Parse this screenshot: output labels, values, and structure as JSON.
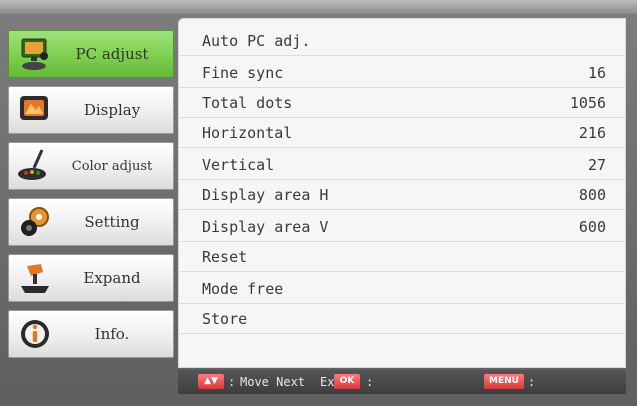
{
  "sidebar": {
    "items": [
      {
        "label": "PC adjust",
        "icon": "monitor-person-icon",
        "active": true
      },
      {
        "label": "Display",
        "icon": "display-icon",
        "active": false
      },
      {
        "label": "Color adjust",
        "icon": "brush-icon",
        "active": false
      },
      {
        "label": "Setting",
        "icon": "gears-icon",
        "active": false
      },
      {
        "label": "Expand",
        "icon": "joystick-icon",
        "active": false
      },
      {
        "label": "Info.",
        "icon": "info-icon",
        "active": false
      }
    ]
  },
  "menu": {
    "rows": [
      {
        "label": "Auto PC adj.",
        "value": ""
      },
      {
        "label": "Fine sync",
        "value": "16"
      },
      {
        "label": "Total dots",
        "value": "1056"
      },
      {
        "label": "Horizontal",
        "value": "216"
      },
      {
        "label": "Vertical",
        "value": "27"
      },
      {
        "label": "Display area H",
        "value": "800"
      },
      {
        "label": "Display area V",
        "value": "600"
      },
      {
        "label": "Reset",
        "value": ""
      },
      {
        "label": "Mode free",
        "value": ""
      },
      {
        "label": "Store",
        "value": ""
      }
    ]
  },
  "footer": {
    "move_key": "▲▼",
    "move_label": "Move Next",
    "exit_text": "Exit",
    "ok_key": "OK",
    "menu_key": "MENU",
    "colon": ":"
  },
  "colors": {
    "active_item": "#7fcf4f",
    "panel_bg": "#f6f6f6",
    "key_red": "#d63a3a"
  }
}
